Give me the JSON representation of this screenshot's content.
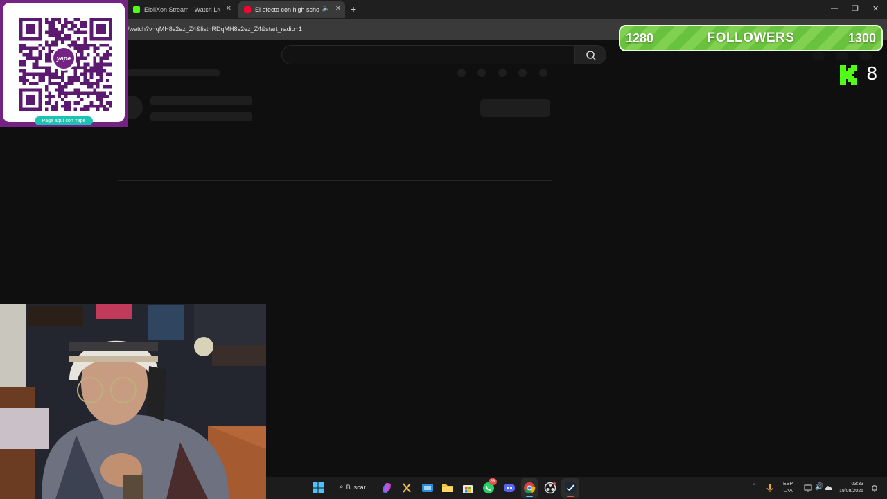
{
  "browser": {
    "tabs": [
      {
        "title": "EloliXon Stream - Watch Live on",
        "favicon_color": "#53fc18"
      },
      {
        "title": "El efecto con high school d",
        "favicon_color": "#ff0033"
      }
    ],
    "url": "/watch?v=qMH8s2ez_Z4&list=RDqMH8s2ez_Z4&start_radio=1"
  },
  "page": {
    "search_icon": "search-icon",
    "loading_state": "skeleton"
  },
  "overlay": {
    "yape": {
      "cta": "Paga aquí con Yape",
      "logo_text": "yape",
      "brand_color": "#742284",
      "accent_color": "#1bc3b3"
    },
    "followers": {
      "current": "1280",
      "label": "FOLLOWERS",
      "goal": "1300"
    },
    "kick": {
      "viewers": "8",
      "brand_color": "#53fc18"
    }
  },
  "taskbar": {
    "search_label": "Buscar",
    "discord_badge": "88",
    "language": "ESP",
    "layout": "LAA",
    "time": "03:33",
    "date": "19/08/2025"
  }
}
